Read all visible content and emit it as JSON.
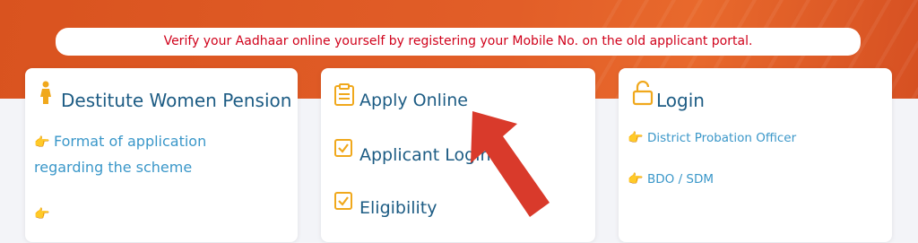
{
  "notice": {
    "text": "Verify your Aadhaar online yourself by registering your Mobile No. on the old applicant portal."
  },
  "scheme_card": {
    "title": "Destitute Women Pension",
    "links": [
      "Format of application regarding the scheme",
      ""
    ]
  },
  "apply_card": {
    "items": [
      "Apply Online",
      "Applicant Login",
      "Eligibility"
    ]
  },
  "login_card": {
    "title": "Login",
    "links": [
      "District Probation Officer",
      "BDO / SDM"
    ]
  },
  "colors": {
    "banner": "#e25e28",
    "notice_text": "#d0021b",
    "title_text": "#1d5c84",
    "link_text": "#3a97c9",
    "icon_gold": "#f0a81c",
    "arrow_red": "#d93a2b"
  }
}
